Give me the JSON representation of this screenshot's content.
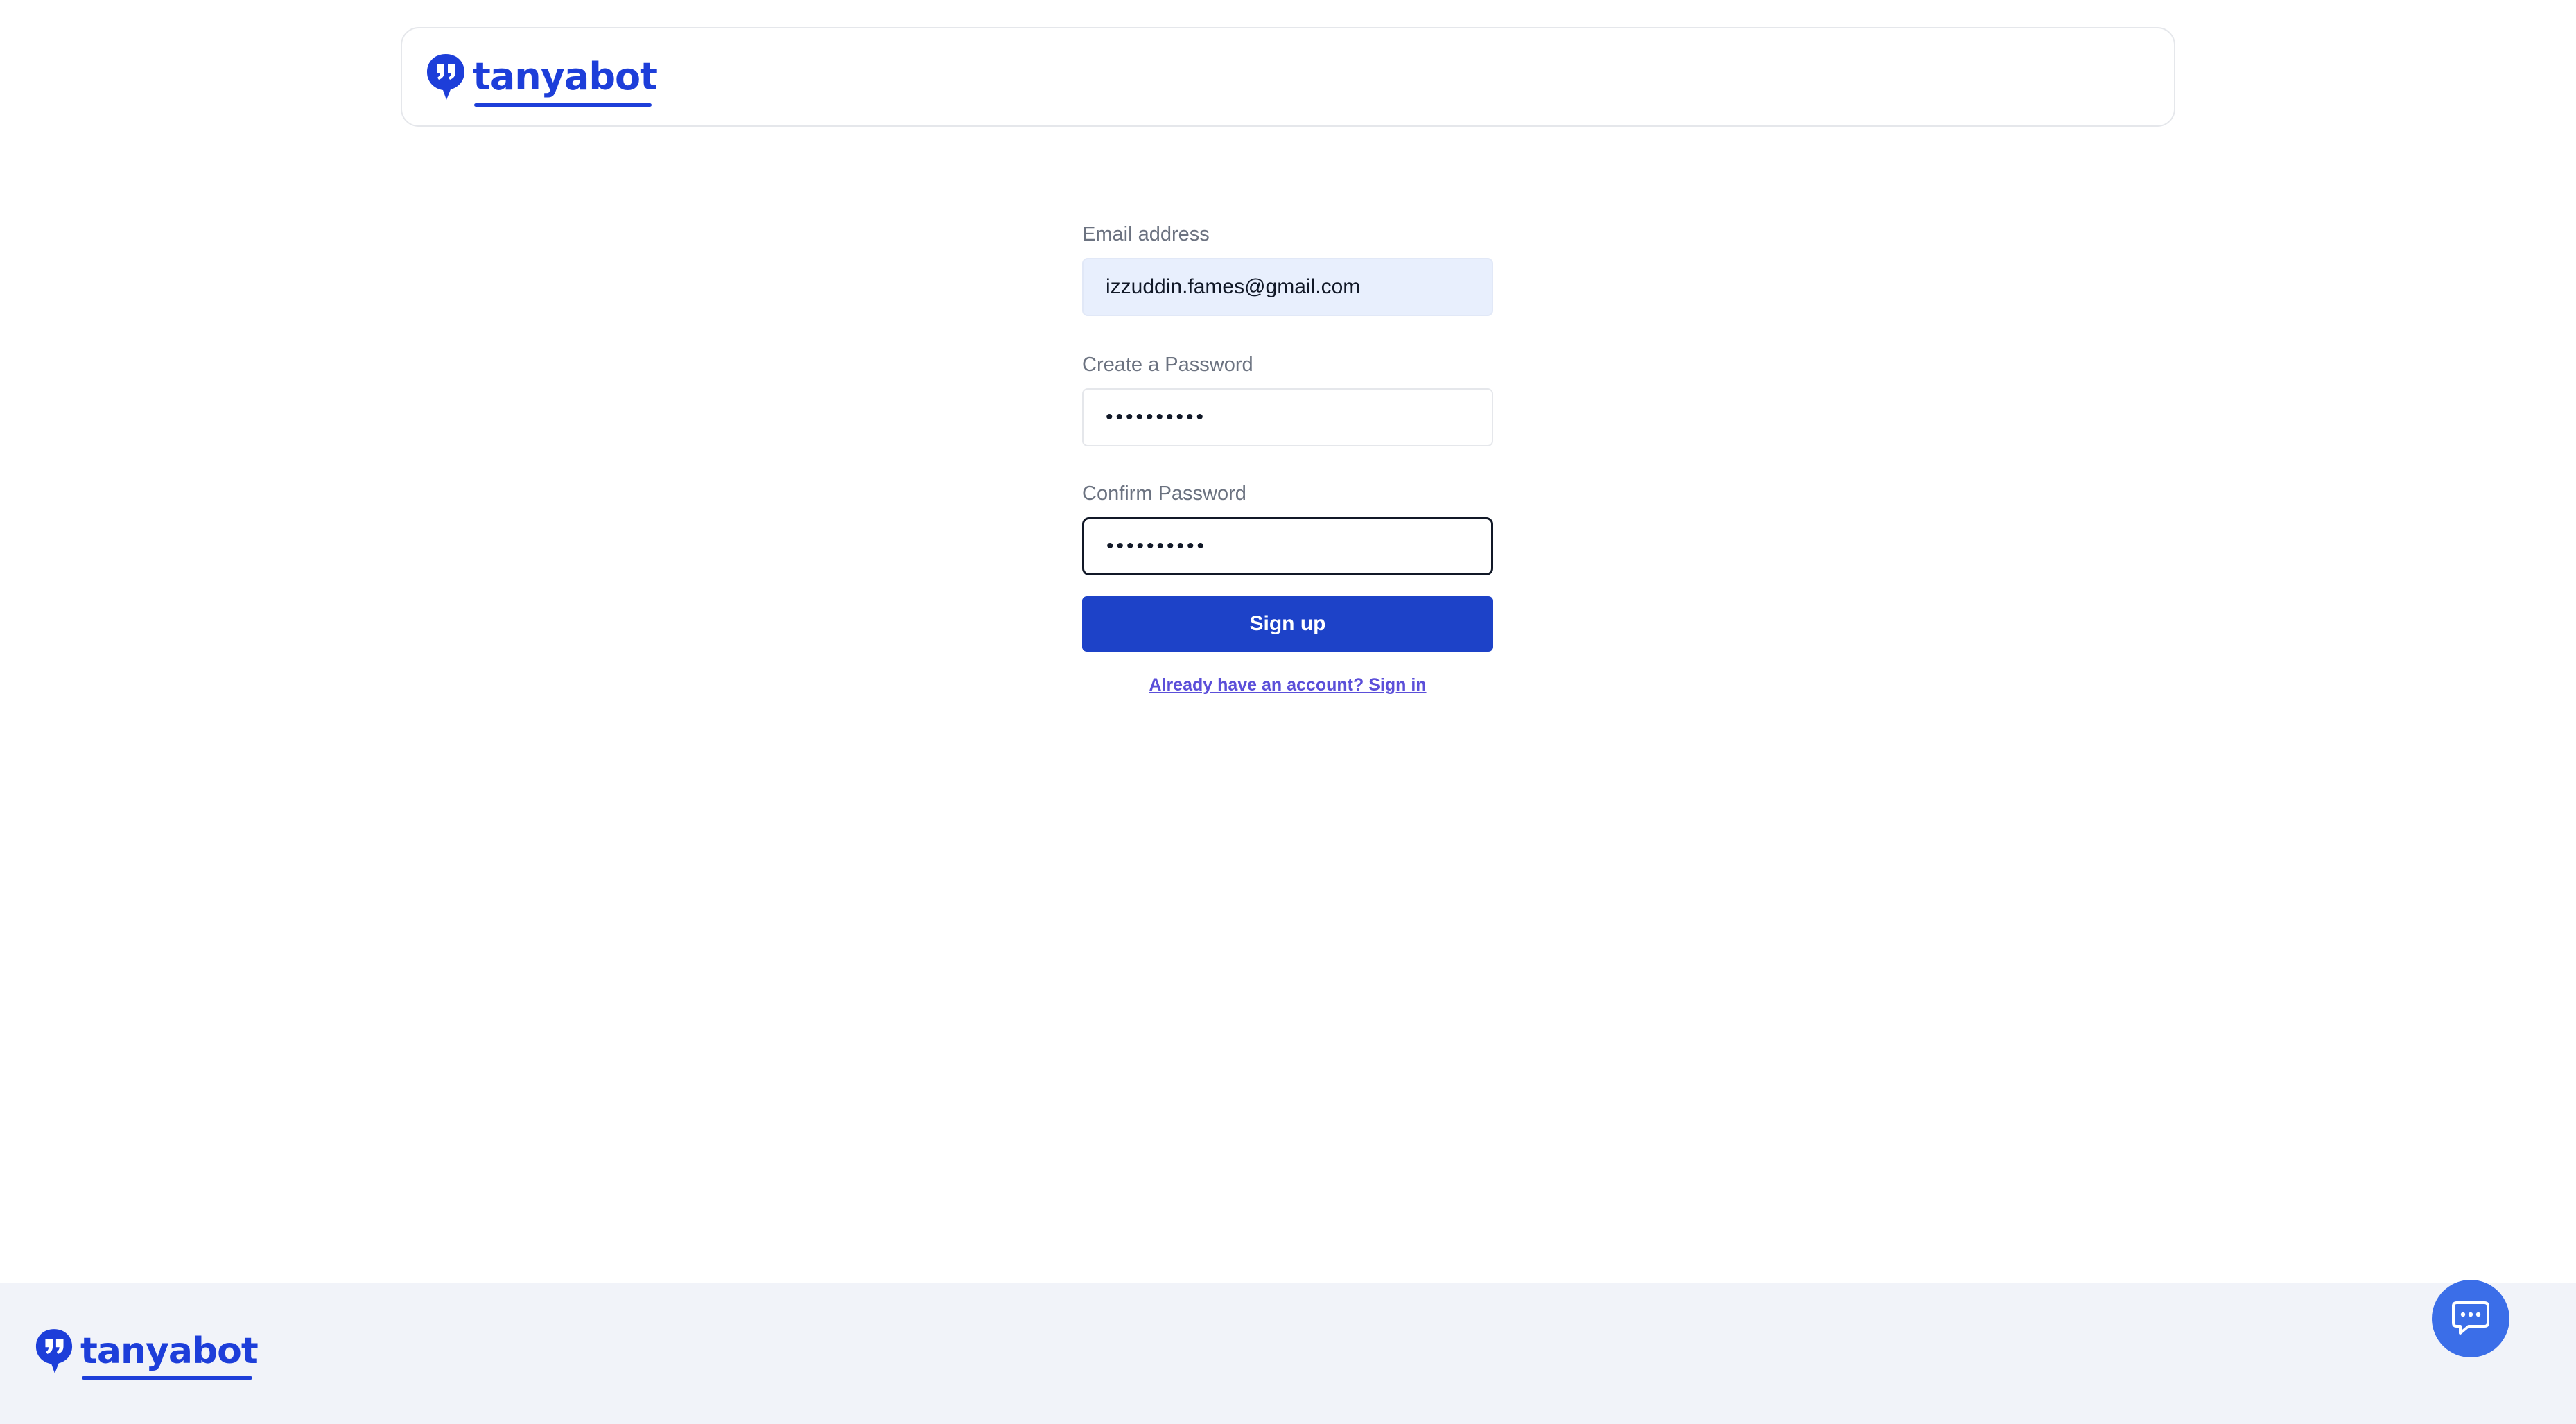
{
  "brand": {
    "name": "tanyabot",
    "color": "#1d3ed9"
  },
  "form": {
    "email_label": "Email address",
    "email_value": "izzuddin.fames@gmail.com",
    "password_label": "Create a Password",
    "password_value": "••••••••••",
    "confirm_label": "Confirm Password",
    "confirm_value": "••••••••••",
    "submit_label": "Sign up",
    "signin_link": "Already have an account? Sign in"
  },
  "icons": {
    "logo": "quote-bubble-icon",
    "chat": "chat-bubble-icon"
  },
  "colors": {
    "primary_button": "#1d42c8",
    "link": "#5b4fd9",
    "chat_button": "#3b6ee8",
    "footer_bg": "#f1f3f9"
  }
}
